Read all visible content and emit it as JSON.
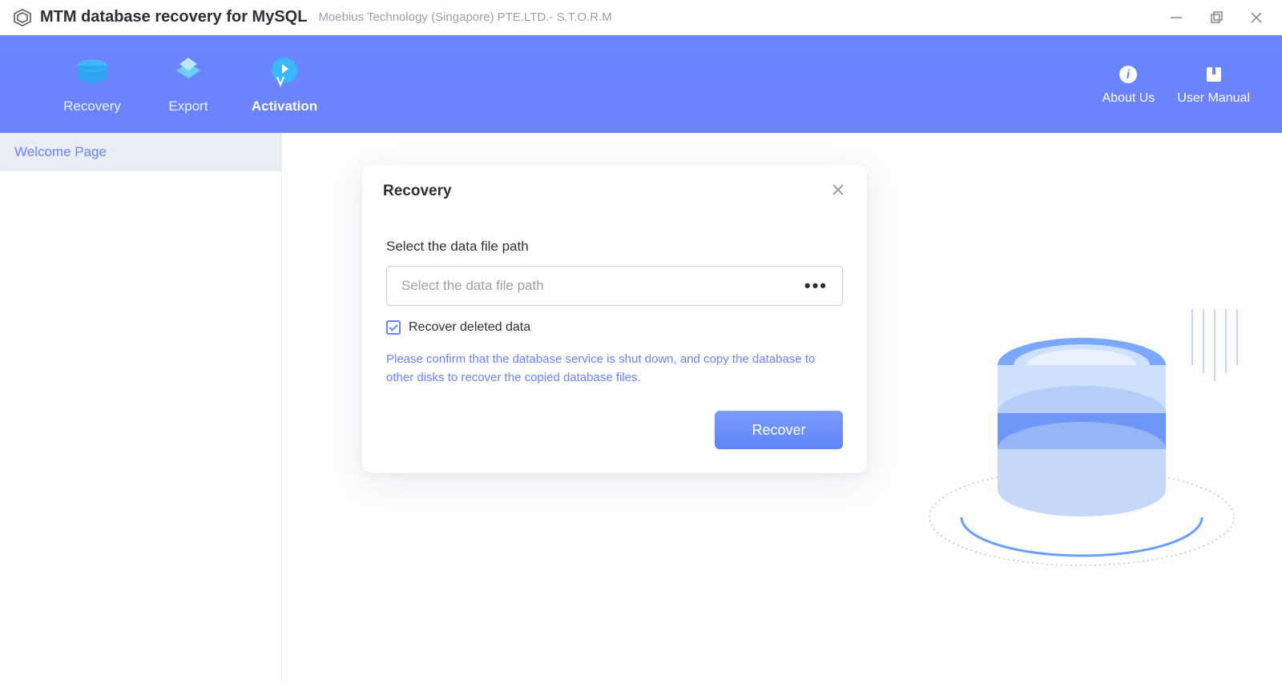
{
  "titlebar": {
    "app_title": "MTM database recovery for MySQL",
    "app_subtitle": "Moebius Technology (Singapore) PTE.LTD.- S.T.O.R.M"
  },
  "toolbar": {
    "items": [
      {
        "label": "Recovery"
      },
      {
        "label": "Export"
      },
      {
        "label": "Activation"
      }
    ],
    "right": [
      {
        "label": "About Us"
      },
      {
        "label": "User Manual"
      }
    ]
  },
  "sidebar": {
    "items": [
      {
        "label": "Welcome Page"
      }
    ]
  },
  "dialog": {
    "title": "Recovery",
    "field_label": "Select the data file path",
    "input_placeholder": "Select the data file path",
    "input_value": "",
    "checkbox_label": "Recover deleted data",
    "checkbox_checked": true,
    "note": "Please confirm that the database service is shut down, and copy the database to other disks to recover the copied database files.",
    "primary_label": "Recover"
  }
}
